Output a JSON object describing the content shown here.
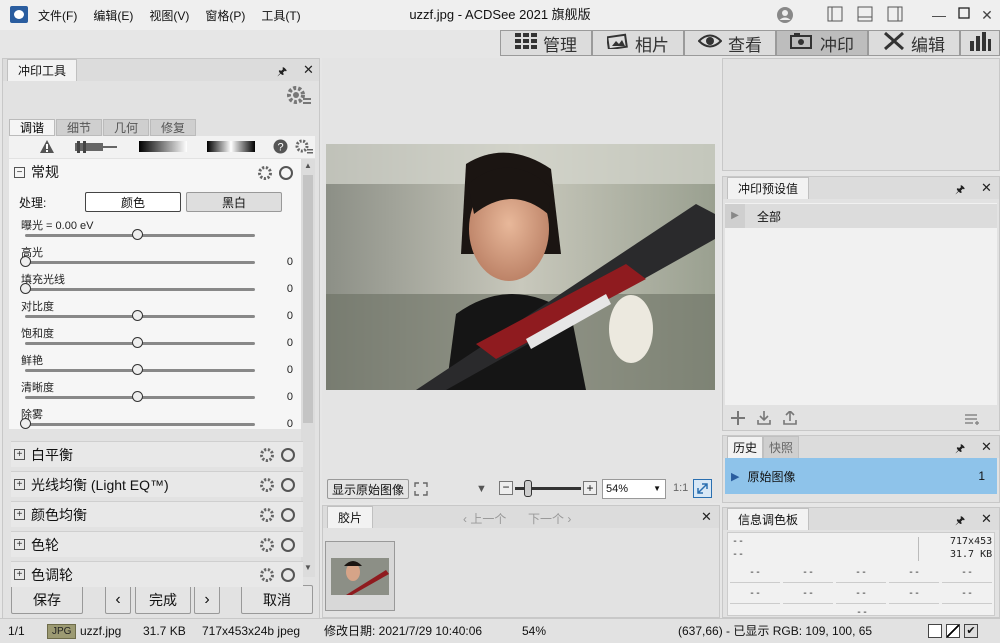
{
  "window": {
    "title": "uzzf.jpg - ACDSee 2021 旗舰版"
  },
  "menu": [
    "文件(F)",
    "编辑(E)",
    "视图(V)",
    "窗格(P)",
    "工具(T)"
  ],
  "modes": [
    {
      "label": "管理"
    },
    {
      "label": "相片"
    },
    {
      "label": "查看"
    },
    {
      "label": "冲印"
    },
    {
      "label": "编辑"
    }
  ],
  "left_panel": {
    "title": "冲印工具",
    "subtabs": [
      "调谐",
      "细节",
      "几何",
      "修复"
    ],
    "general": {
      "title": "常规",
      "process_label": "处理:",
      "color_btn": "颜色",
      "bw_btn": "黑白"
    },
    "sliders": [
      {
        "label": "曝光 = 0.00 eV",
        "value": "",
        "pos": 0.5
      },
      {
        "label": "高光",
        "value": "0",
        "pos": 0
      },
      {
        "label": "填充光线",
        "value": "0",
        "pos": 0
      },
      {
        "label": "对比度",
        "value": "0",
        "pos": 0.5
      },
      {
        "label": "饱和度",
        "value": "0",
        "pos": 0.5
      },
      {
        "label": "鲜艳",
        "value": "0",
        "pos": 0.5
      },
      {
        "label": "清晰度",
        "value": "0",
        "pos": 0.5
      },
      {
        "label": "除雾",
        "value": "0",
        "pos": 0
      }
    ],
    "sections": [
      "白平衡",
      "光线均衡 (Light EQ™)",
      "颜色均衡",
      "色轮",
      "色调轮"
    ],
    "save_btn": "保存",
    "done_btn": "完成",
    "cancel_btn": "取消"
  },
  "center": {
    "show_original": "显示原始图像",
    "zoom": "54%",
    "ratio": "1:1"
  },
  "filmstrip": {
    "title": "胶片",
    "prev": "上一个",
    "next": "下一个"
  },
  "right": {
    "presets_title": "冲印预设值",
    "presets_item": "全部",
    "history_tab": "历史",
    "snapshot_tab": "快照",
    "history_item": "原始图像",
    "history_count": "1",
    "info_title": "信息调色板",
    "info_dims": "717x453",
    "info_size": "31.7 KB",
    "dash": "--"
  },
  "status": {
    "index": "1/1",
    "format": "JPG",
    "filename": "uzzf.jpg",
    "filesize": "31.7 KB",
    "dims": "717x453x24b jpeg",
    "modified": "修改日期: 2021/7/29 10:40:06",
    "zoom": "54%",
    "pixel": "(637,66) - 已显示 RGB: 109, 100, 65"
  },
  "colors": {
    "accent": "#2a5d9f",
    "history_selected": "#8ec3ea"
  }
}
